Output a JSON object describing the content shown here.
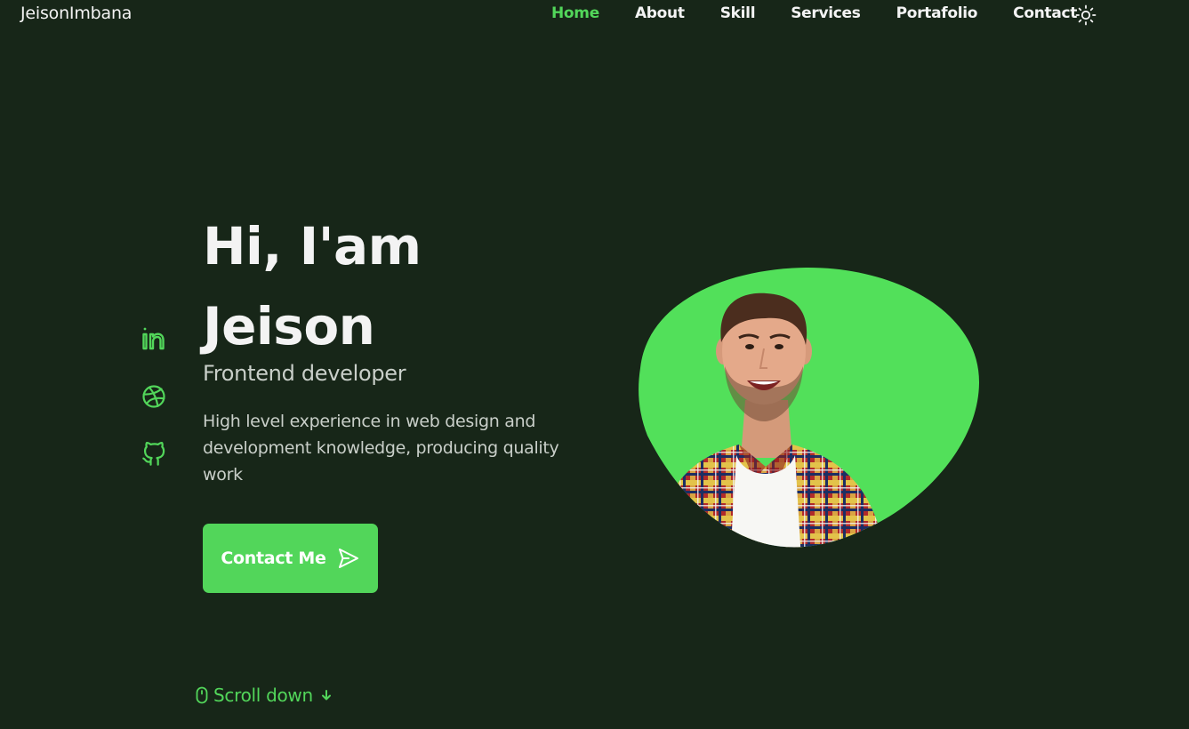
{
  "header": {
    "logo": "JeisonImbana",
    "nav": [
      {
        "label": "Home",
        "active": true
      },
      {
        "label": "About",
        "active": false
      },
      {
        "label": "Skill",
        "active": false
      },
      {
        "label": "Services",
        "active": false
      },
      {
        "label": "Portafolio",
        "active": false
      },
      {
        "label": "Contact",
        "active": false
      }
    ],
    "theme_icon": "sun-icon"
  },
  "socials": [
    {
      "name": "linkedin",
      "icon": "linkedin-icon"
    },
    {
      "name": "dribbble",
      "icon": "dribbble-icon"
    },
    {
      "name": "github",
      "icon": "github-icon"
    }
  ],
  "hero": {
    "title_line1": "Hi, I'am",
    "title_line2": "Jeison",
    "subtitle": "Frontend developer",
    "description": "High level experience in web design and development knowledge, producing quality work",
    "button_label": "Contact Me",
    "button_icon": "send-icon"
  },
  "scroll": {
    "label": "Scroll down",
    "mouse_icon": "mouse-icon",
    "arrow_icon": "arrow-down-icon"
  },
  "colors": {
    "background": "#172618",
    "accent": "#52d65a",
    "text": "#f3f3f3",
    "muted_text": "#c9cfc9"
  }
}
